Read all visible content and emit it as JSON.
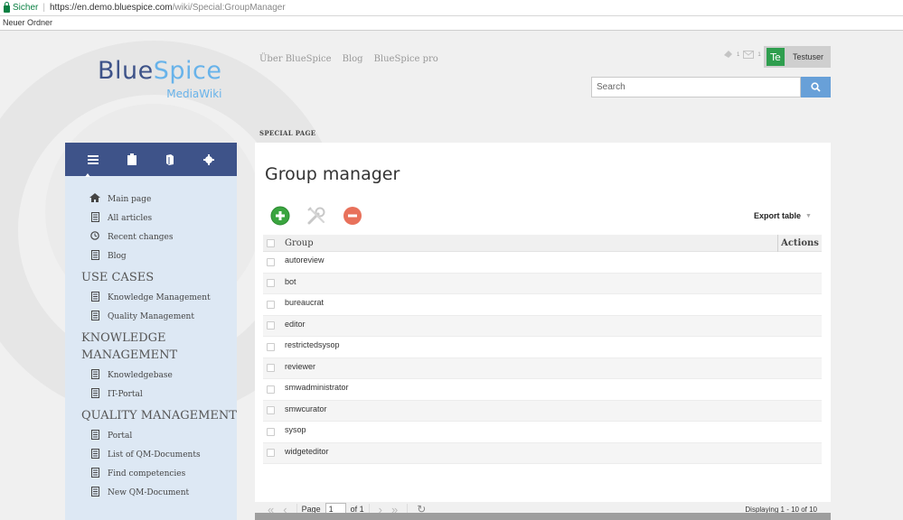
{
  "browser": {
    "secure_label": "Sicher",
    "url_host": "https://en.demo.bluespice.com",
    "url_path": "/wiki/Special:GroupManager",
    "bookmark": "Neuer Ordner"
  },
  "logo": {
    "main_a": "Blue",
    "main_b": "Spice",
    "sub": "MediaWiki"
  },
  "topnav": [
    "Über BlueSpice",
    "Blog",
    "BlueSpice pro"
  ],
  "user": {
    "avatar": "Te",
    "name": "Testuser",
    "notif_count": "1",
    "mail_count": "1"
  },
  "search": {
    "placeholder": "Search"
  },
  "sidebar": {
    "tabs": [
      "menu-icon",
      "clipboard-icon",
      "book-icon",
      "gear-icon"
    ],
    "items": [
      {
        "label": "Main page",
        "icon": "home-icon"
      },
      {
        "label": "All articles",
        "icon": "document-icon"
      },
      {
        "label": "Recent changes",
        "icon": "clock-icon"
      },
      {
        "label": "Blog",
        "icon": "document-icon"
      }
    ],
    "sections": [
      {
        "heading": "USE CASES",
        "items": [
          "Knowledge Management",
          "Quality Management"
        ]
      },
      {
        "heading": "KNOWLEDGE MANAGEMENT",
        "items": [
          "Knowledgebase",
          "IT-Portal"
        ]
      },
      {
        "heading": "QUALITY MANAGEMENT",
        "items": [
          "Portal",
          "List of QM-Documents",
          "Find competencies",
          "New QM-Document"
        ]
      }
    ]
  },
  "content": {
    "special_label": "SPECIAL PAGE",
    "title": "Group manager",
    "export_label": "Export table",
    "columns": {
      "group": "Group",
      "actions": "Actions"
    },
    "groups": [
      "autoreview",
      "bot",
      "bureaucrat",
      "editor",
      "restrictedsysop",
      "reviewer",
      "smwadministrator",
      "smwcurator",
      "sysop",
      "widgeteditor"
    ],
    "pager": {
      "page_label": "Page",
      "page_value": "1",
      "of_label": "of 1",
      "displaying": "Displaying 1 - 10 of 10"
    }
  },
  "colors": {
    "brand": "#3e5389",
    "accent": "#68b3ea",
    "add": "#3aa53f",
    "remove": "#e8715b",
    "sidebar_bg": "#dde8f4"
  }
}
